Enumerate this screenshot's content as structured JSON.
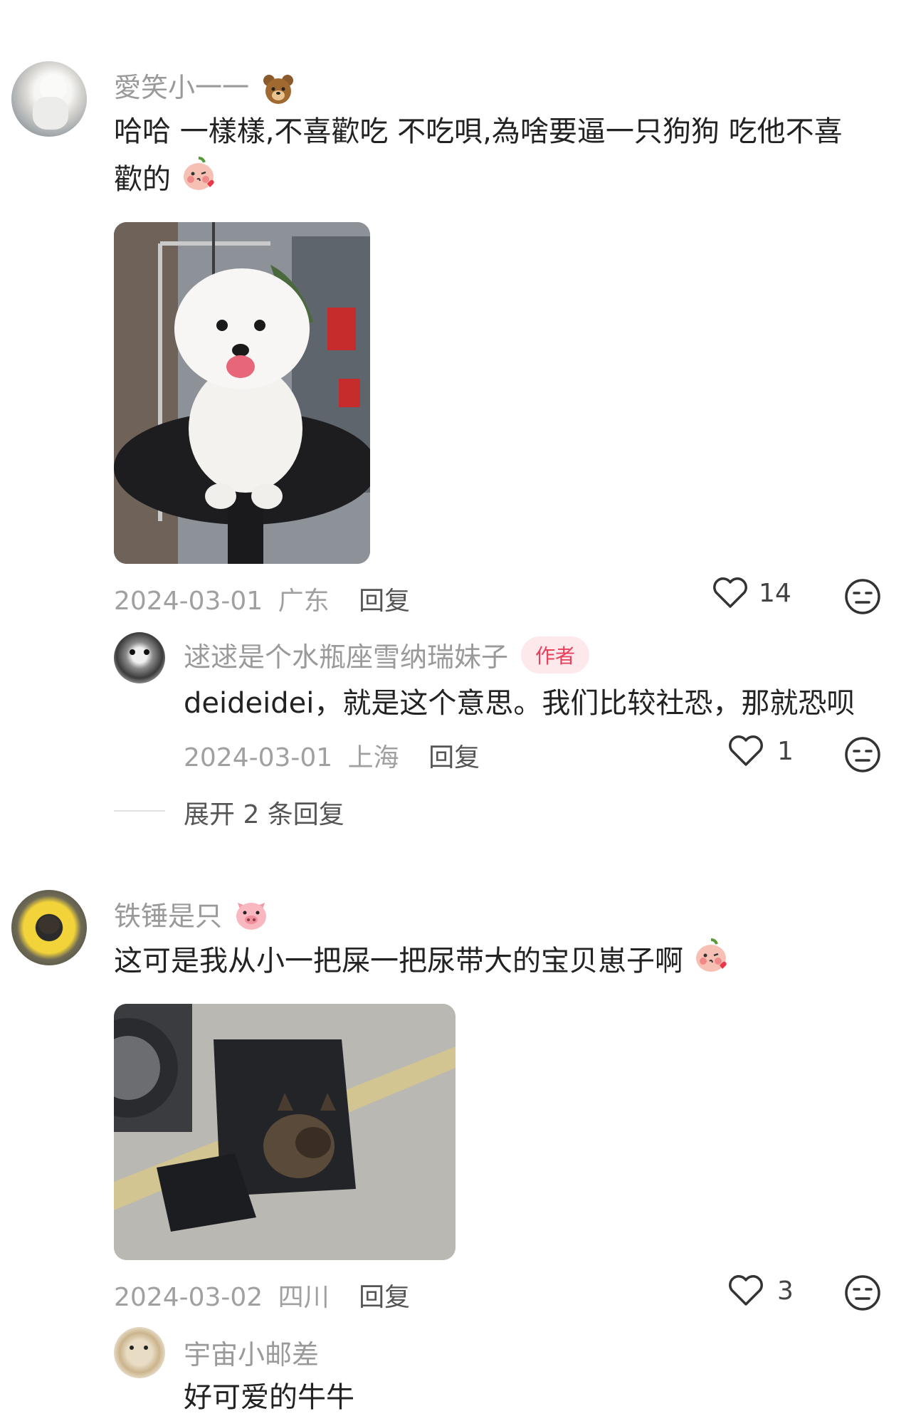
{
  "comments": [
    {
      "username": "愛笑小一一",
      "username_emoji": "bear",
      "text_line1": "哈哈 一樣樣,不喜歡吃 不吃唄,為啥要逼一只狗狗 吃他不喜",
      "text_line2": "歡的",
      "text_emoji": "kiss-peach",
      "date": "2024-03-01",
      "location": "广东",
      "reply_label": "回复",
      "likes": "14"
    },
    {
      "username": "铁锤是只",
      "username_emoji": "pig",
      "text": "这可是我从小一把屎一把尿带大的宝贝崽子啊",
      "text_emoji": "kiss-peach",
      "date": "2024-03-02",
      "location": "四川",
      "reply_label": "回复",
      "likes": "3"
    }
  ],
  "reply1": {
    "username": "逑逑是个水瓶座雪纳瑞妹子",
    "badge": "作者",
    "text": "deideidei，就是这个意思。我们比较社恐，那就恐呗",
    "date": "2024-03-01",
    "location": "上海",
    "reply_label": "回复",
    "likes": "1"
  },
  "expand_label": "展开 2 条回复",
  "reply2": {
    "username": "宇宙小邮差",
    "text": "好可爱的牛牛"
  },
  "colors": {
    "accent": "#e6405a",
    "muted": "#9a9a9a"
  }
}
